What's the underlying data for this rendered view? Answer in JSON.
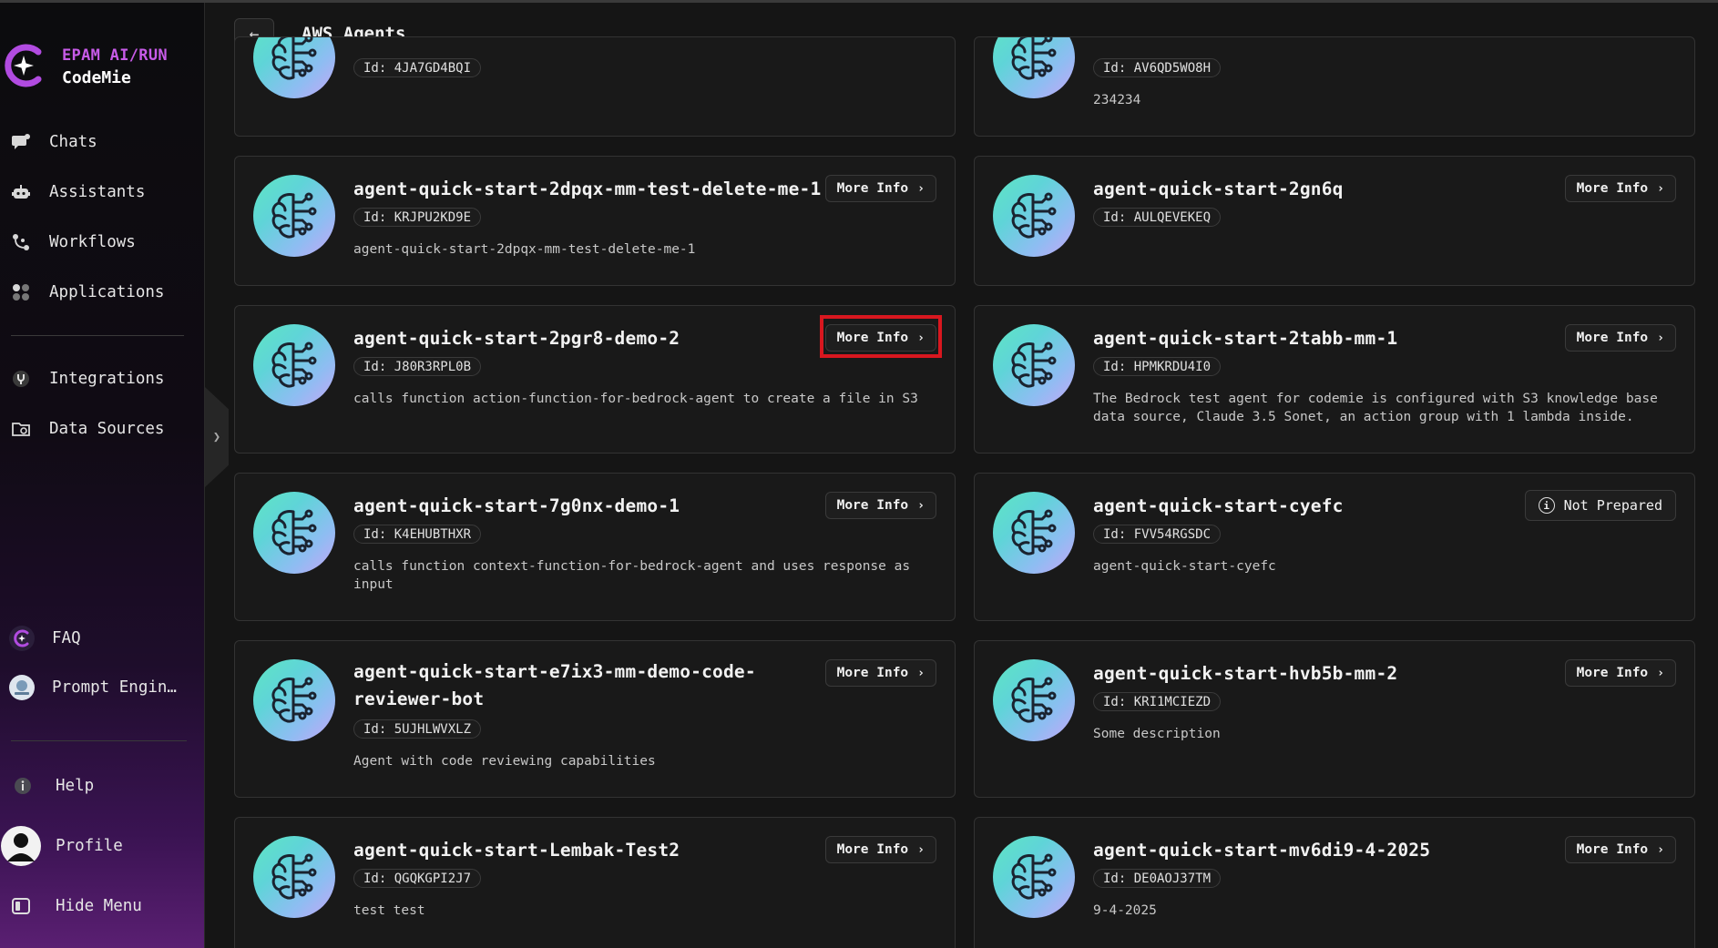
{
  "brand": {
    "line1": "EPAM AI/RUN",
    "line2": "CodeMie"
  },
  "sidebar": {
    "items": [
      {
        "label": "Chats",
        "icon": "chat-icon"
      },
      {
        "label": "Assistants",
        "icon": "robot-icon"
      },
      {
        "label": "Workflows",
        "icon": "workflow-icon"
      },
      {
        "label": "Applications",
        "icon": "apps-icon"
      },
      {
        "label": "Integrations",
        "icon": "integrations-icon"
      },
      {
        "label": "Data Sources",
        "icon": "data-sources-icon"
      }
    ],
    "bottom": [
      {
        "label": "FAQ",
        "icon": "faq-icon"
      },
      {
        "label": "Prompt Engin…",
        "icon": "prompt-engineering-icon"
      },
      {
        "label": "Help",
        "icon": "help-icon"
      },
      {
        "label": "Profile",
        "icon": "profile-avatar"
      },
      {
        "label": "Hide Menu",
        "icon": "hide-menu-icon"
      }
    ]
  },
  "header": {
    "back_icon": "←",
    "title": "AWS Agents"
  },
  "colors": {
    "accent": "#c75be8",
    "highlight": "#d8171f",
    "card_bg": "#191919"
  },
  "more_info_label": "More Info",
  "more_info_chevron": "›",
  "cards": [
    {
      "name": "",
      "id": "Id: 4JA7GD4BQI",
      "desc": "",
      "button": ""
    },
    {
      "name": "",
      "id": "Id: AV6QD5WO8H",
      "desc": "234234",
      "button": ""
    },
    {
      "name": "agent-quick-start-2dpqx-mm-test-delete-me-1",
      "id": "Id: KRJPU2KD9E",
      "desc": "agent-quick-start-2dpqx-mm-test-delete-me-1",
      "button": "More Info"
    },
    {
      "name": "agent-quick-start-2gn6q",
      "id": "Id: AULQEVEKEQ",
      "desc": "",
      "button": "More Info"
    },
    {
      "name": "agent-quick-start-2pgr8-demo-2",
      "id": "Id: J80R3RPL0B",
      "desc": "calls function action-function-for-bedrock-agent to create a file in S3",
      "button": "More Info"
    },
    {
      "name": "agent-quick-start-2tabb-mm-1",
      "id": "Id: HPMKRDU4I0",
      "desc": "The Bedrock test agent for codemie is configured with S3 knowledge base data source, Claude 3.5 Sonet, an action group with 1 lambda inside.",
      "button": "More Info"
    },
    {
      "name": "agent-quick-start-7g0nx-demo-1",
      "id": "Id: K4EHUBTHXR",
      "desc": "calls function context-function-for-bedrock-agent and uses response as input",
      "button": "More Info"
    },
    {
      "name": "agent-quick-start-cyefc",
      "id": "Id: FVV54RGSDC",
      "desc": "agent-quick-start-cyefc",
      "status": "Not Prepared"
    },
    {
      "name": "agent-quick-start-e7ix3-mm-demo-code-reviewer-bot",
      "id": "Id: 5UJHLWVXLZ",
      "desc": "Agent with code reviewing capabilities",
      "button": "More Info"
    },
    {
      "name": "agent-quick-start-hvb5b-mm-2",
      "id": "Id: KRI1MCIEZD",
      "desc": "Some description",
      "button": "More Info"
    },
    {
      "name": "agent-quick-start-Lembak-Test2",
      "id": "Id: QGQKGPI2J7",
      "desc": "test test",
      "button": "More Info"
    },
    {
      "name": "agent-quick-start-mv6di9-4-2025",
      "id": "Id: DE0AOJ37TM",
      "desc": "9-4-2025",
      "button": "More Info"
    }
  ]
}
